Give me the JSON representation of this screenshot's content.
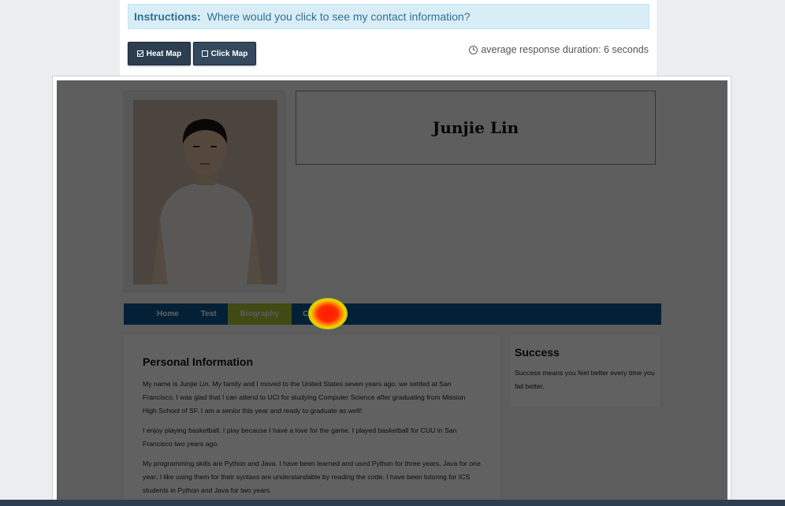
{
  "instructions": {
    "label": "Instructions:",
    "text": "Where would you click to see my contact information?"
  },
  "toolbar": {
    "heat_map_label": "Heat Map",
    "click_map_label": "Click Map",
    "duration_text": "average response duration: 6 seconds"
  },
  "site": {
    "name": "Junjie Lin",
    "nav": [
      "Home",
      "Test",
      "Biography",
      "Contact"
    ],
    "active_nav": "Biography",
    "personal_info": {
      "heading": "Personal Information",
      "paragraphs": [
        "My name is Junjie Lin. My family and I moved to the United States seven years ago, we settled at San Francisco. I was glad that I can attend to UCI for studying Computer Science after graduating from Mission High School of SF. I am a senior this year and ready to graduate as well!",
        "I enjoy playing basketball. I play because I have a love for the game. I played basketball for CUU in San Francisco two years ago.",
        "My programming skills are Python and Java. I have been learned and used Python for three years, Java for one year; I like using them for their syntaxs are understandable by reading the code. I have been tutoring for ICS students in Python and Java for two years."
      ]
    },
    "success": {
      "heading": "Success",
      "text": "Success means you feel better every time you fail better."
    }
  },
  "colors": {
    "toolbar_button": "#2c3e50",
    "nav_bar": "#0b5690",
    "nav_active": "#a8c230",
    "instructions_bg": "#d9edf7"
  }
}
